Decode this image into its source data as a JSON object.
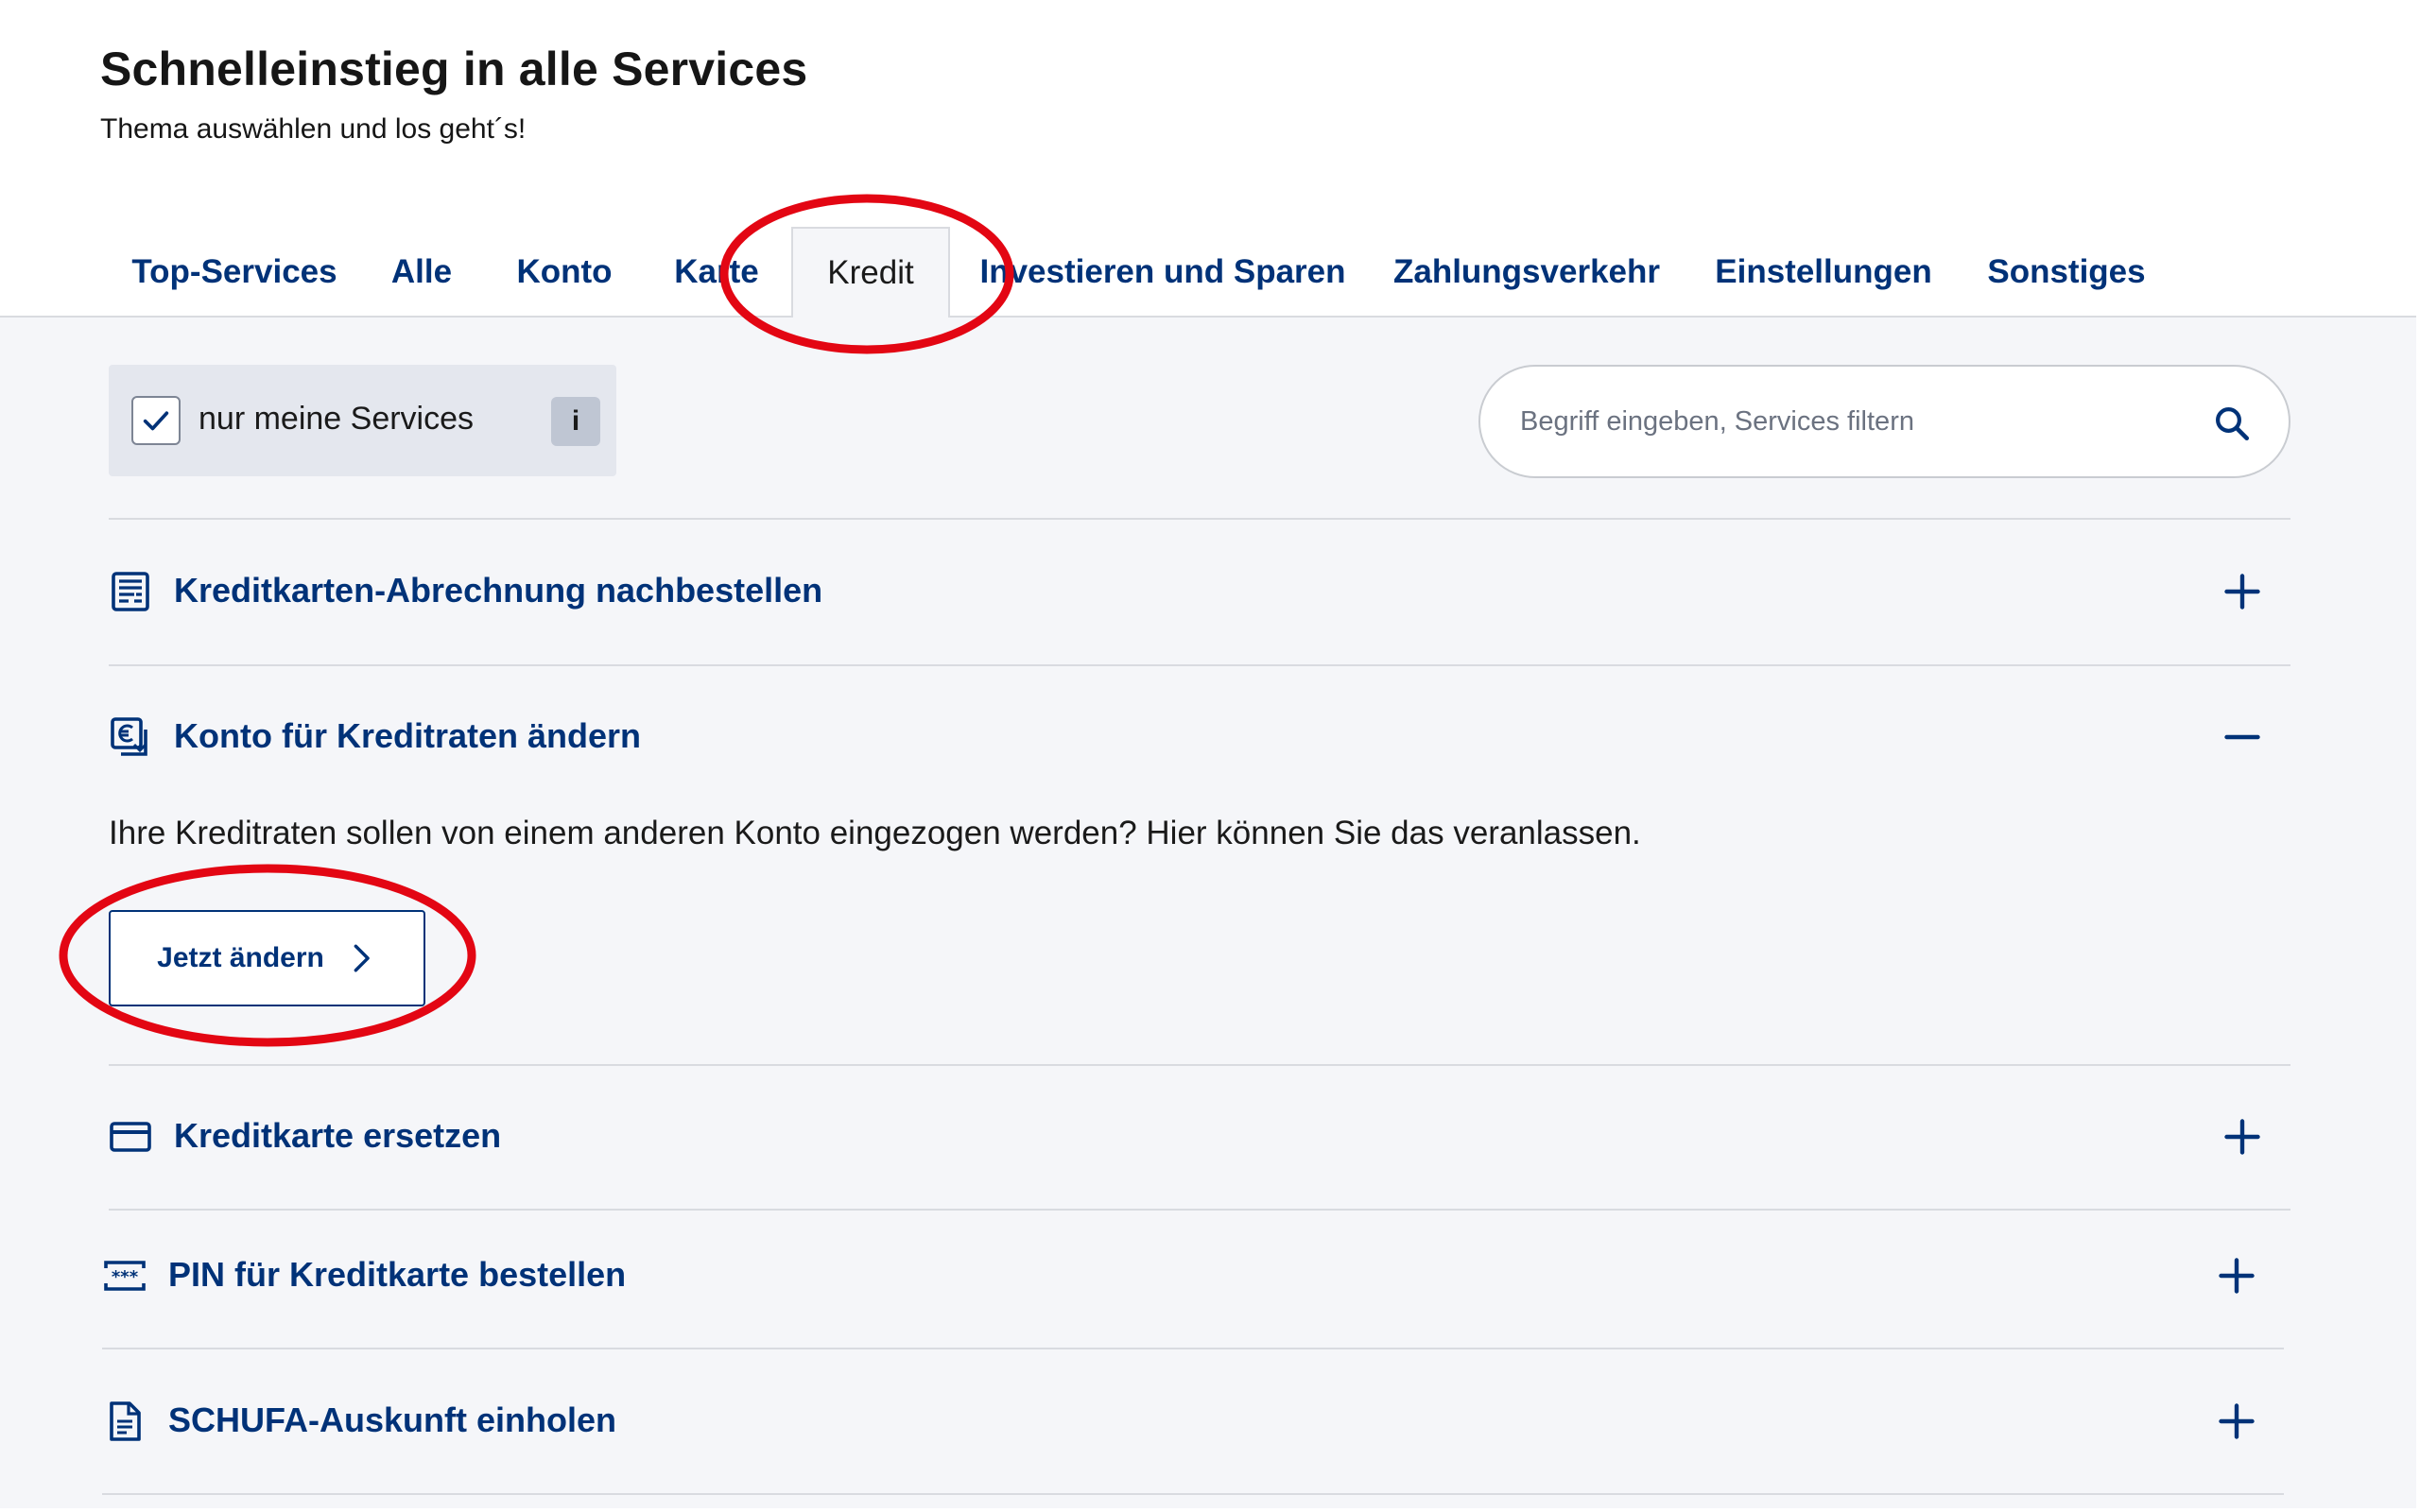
{
  "header": {
    "title": "Schnelleinstieg in alle Services",
    "subtitle": "Thema auswählen und los geht´s!"
  },
  "tabs": [
    {
      "label": "Top-Services",
      "active": false
    },
    {
      "label": "Alle",
      "active": false
    },
    {
      "label": "Konto",
      "active": false
    },
    {
      "label": "Karte",
      "active": false
    },
    {
      "label": "Kredit",
      "active": true
    },
    {
      "label": "Investieren und Sparen",
      "active": false
    },
    {
      "label": "Zahlungsverkehr",
      "active": false
    },
    {
      "label": "Einstellungen",
      "active": false
    },
    {
      "label": "Sonstiges",
      "active": false
    }
  ],
  "filter": {
    "checked": true,
    "label": "nur meine Services",
    "info_label": "i"
  },
  "search": {
    "placeholder": "Begriff eingeben, Services filtern",
    "icon": "search-icon"
  },
  "items": [
    {
      "label": "Kreditkarten-Abrechnung nachbestellen",
      "icon": "statement-icon",
      "expanded": false
    },
    {
      "label": "Konto für Kreditraten ändern",
      "icon": "euro-transfer-icon",
      "expanded": true,
      "description": "Ihre Kreditraten sollen von einem anderen Konto eingezogen werden? Hier können Sie das veranlassen.",
      "action_label": "Jetzt ändern"
    },
    {
      "label": "Kreditkarte ersetzen",
      "icon": "credit-card-icon",
      "expanded": false
    },
    {
      "label": "PIN für Kreditkarte bestellen",
      "icon": "pin-code-icon",
      "expanded": false
    },
    {
      "label": "SCHUFA-Auskunft einholen",
      "icon": "document-icon",
      "expanded": false
    }
  ],
  "colors": {
    "brand": "#003278",
    "background": "#f5f6f9",
    "annotation": "#e30613"
  }
}
